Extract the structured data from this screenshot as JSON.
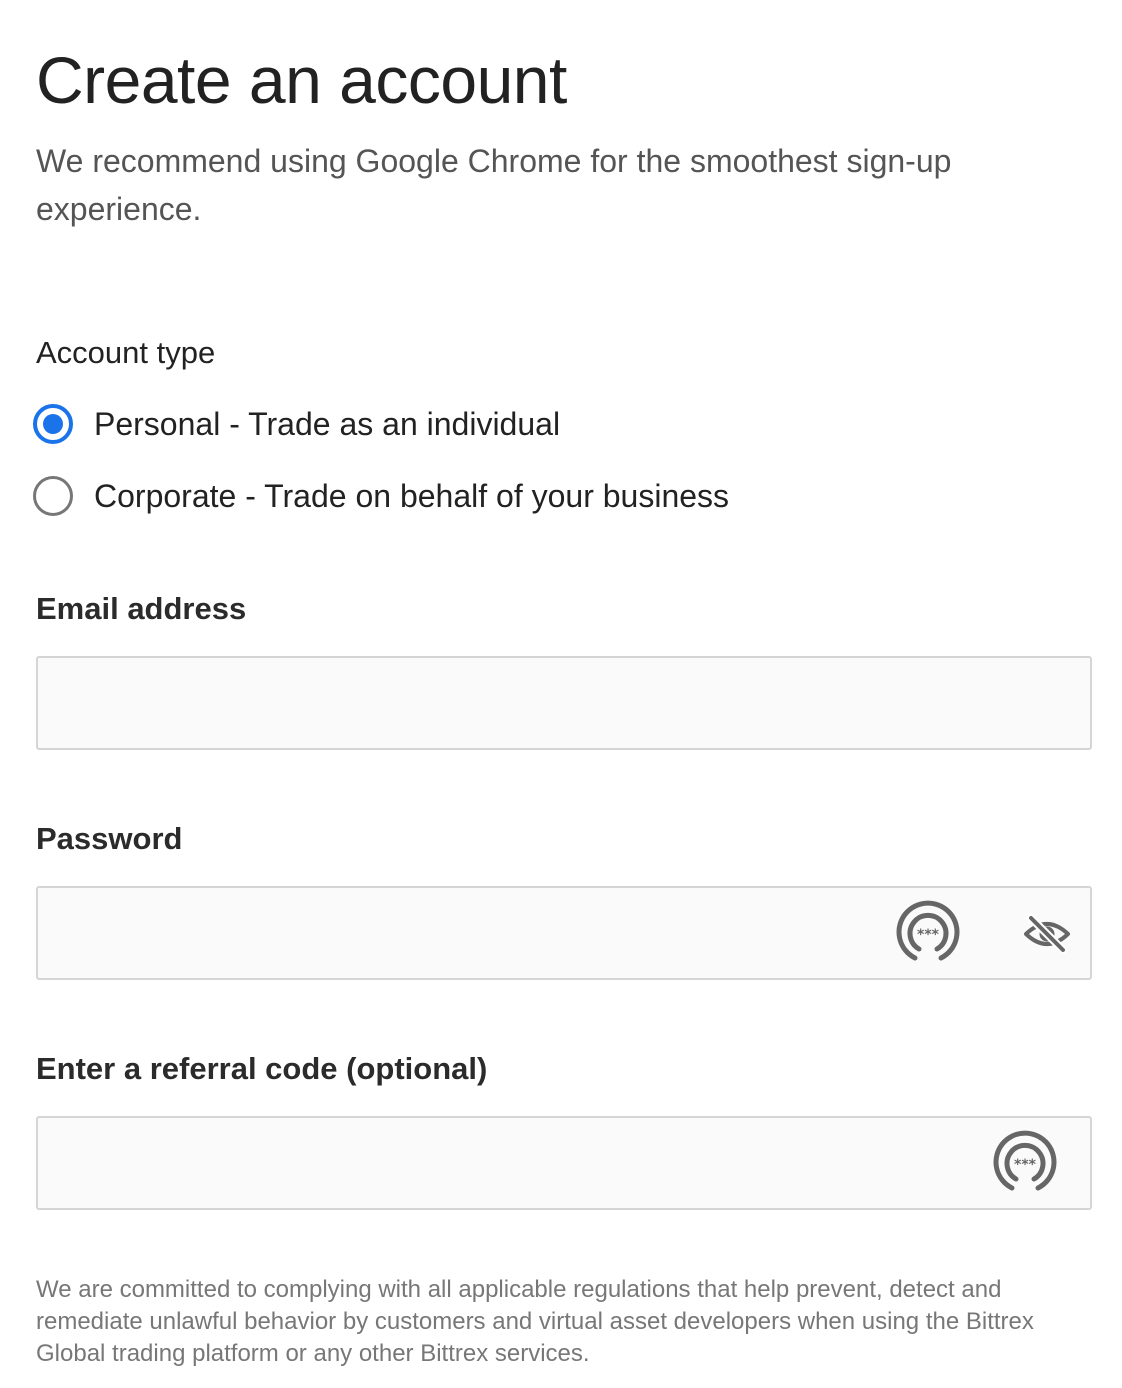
{
  "page": {
    "title": "Create an account",
    "subtitle": "We recommend using Google Chrome for the smoothest sign-up experience."
  },
  "account_type": {
    "label": "Account type",
    "selected": "personal",
    "options": [
      {
        "id": "personal",
        "label": "Personal - Trade as an individual",
        "checked": true
      },
      {
        "id": "corporate",
        "label": "Corporate - Trade on behalf of your business",
        "checked": false
      }
    ]
  },
  "email": {
    "label": "Email address",
    "value": "",
    "placeholder": ""
  },
  "password": {
    "label": "Password",
    "value": "",
    "placeholder": "",
    "icons": [
      "password-manager-icon",
      "eye-slash-icon"
    ]
  },
  "referral": {
    "label": "Enter a referral code (optional)",
    "value": "",
    "placeholder": "",
    "icons": [
      "password-manager-icon"
    ]
  },
  "disclaimer": "We are committed to complying with all applicable regulations that help prevent, detect and remediate unlawful behavior by customers and virtual asset developers when using the Bittrex Global trading platform or any other Bittrex services.",
  "colors": {
    "accent": "#1a73e8",
    "text": "#222222",
    "muted": "#777777",
    "input_border": "#d5d5d5",
    "input_bg": "#fafafa"
  }
}
